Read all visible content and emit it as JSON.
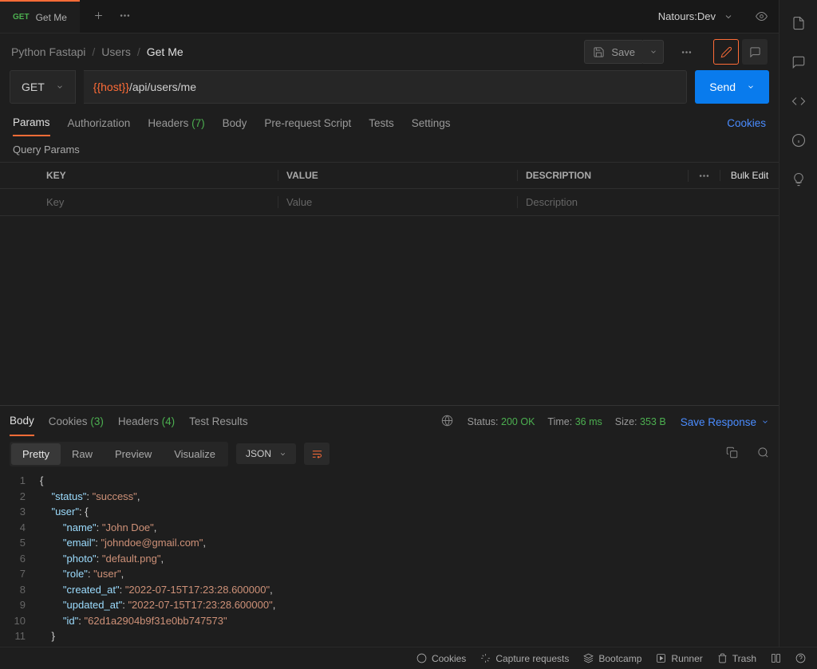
{
  "tab": {
    "method": "GET",
    "title": "Get Me"
  },
  "environment": "Natours:Dev",
  "breadcrumb": {
    "a": "Python Fastapi",
    "b": "Users",
    "c": "Get Me"
  },
  "toolbar": {
    "save": "Save"
  },
  "request": {
    "method": "GET",
    "url_var": "{{host}}",
    "url_path": "/api/users/me",
    "send": "Send"
  },
  "req_tabs": {
    "params": "Params",
    "auth": "Authorization",
    "headers_label": "Headers",
    "headers_count": "(7)",
    "body": "Body",
    "prs": "Pre-request Script",
    "tests": "Tests",
    "settings": "Settings",
    "cookies": "Cookies"
  },
  "qp_title": "Query Params",
  "cols": {
    "key": "KEY",
    "value": "VALUE",
    "desc": "DESCRIPTION",
    "bulk": "Bulk Edit"
  },
  "placeholders": {
    "key": "Key",
    "value": "Value",
    "desc": "Description"
  },
  "resp_tabs": {
    "body": "Body",
    "cookies_label": "Cookies",
    "cookies_count": "(3)",
    "headers_label": "Headers",
    "headers_count": "(4)",
    "test_results": "Test Results"
  },
  "resp_meta": {
    "status_lbl": "Status:",
    "status_val": "200 OK",
    "time_lbl": "Time:",
    "time_val": "36 ms",
    "size_lbl": "Size:",
    "size_val": "353 B",
    "save_response": "Save Response"
  },
  "view_tabs": {
    "pretty": "Pretty",
    "raw": "Raw",
    "preview": "Preview",
    "visualize": "Visualize",
    "format": "JSON"
  },
  "response_body": {
    "status": "success",
    "user": {
      "name": "John Doe",
      "email": "johndoe@gmail.com",
      "photo": "default.png",
      "role": "user",
      "created_at": "2022-07-15T17:23:28.600000",
      "updated_at": "2022-07-15T17:23:28.600000",
      "id": "62d1a2904b9f31e0bb747573"
    }
  },
  "footer": {
    "cookies": "Cookies",
    "capture": "Capture requests",
    "bootcamp": "Bootcamp",
    "runner": "Runner",
    "trash": "Trash"
  }
}
